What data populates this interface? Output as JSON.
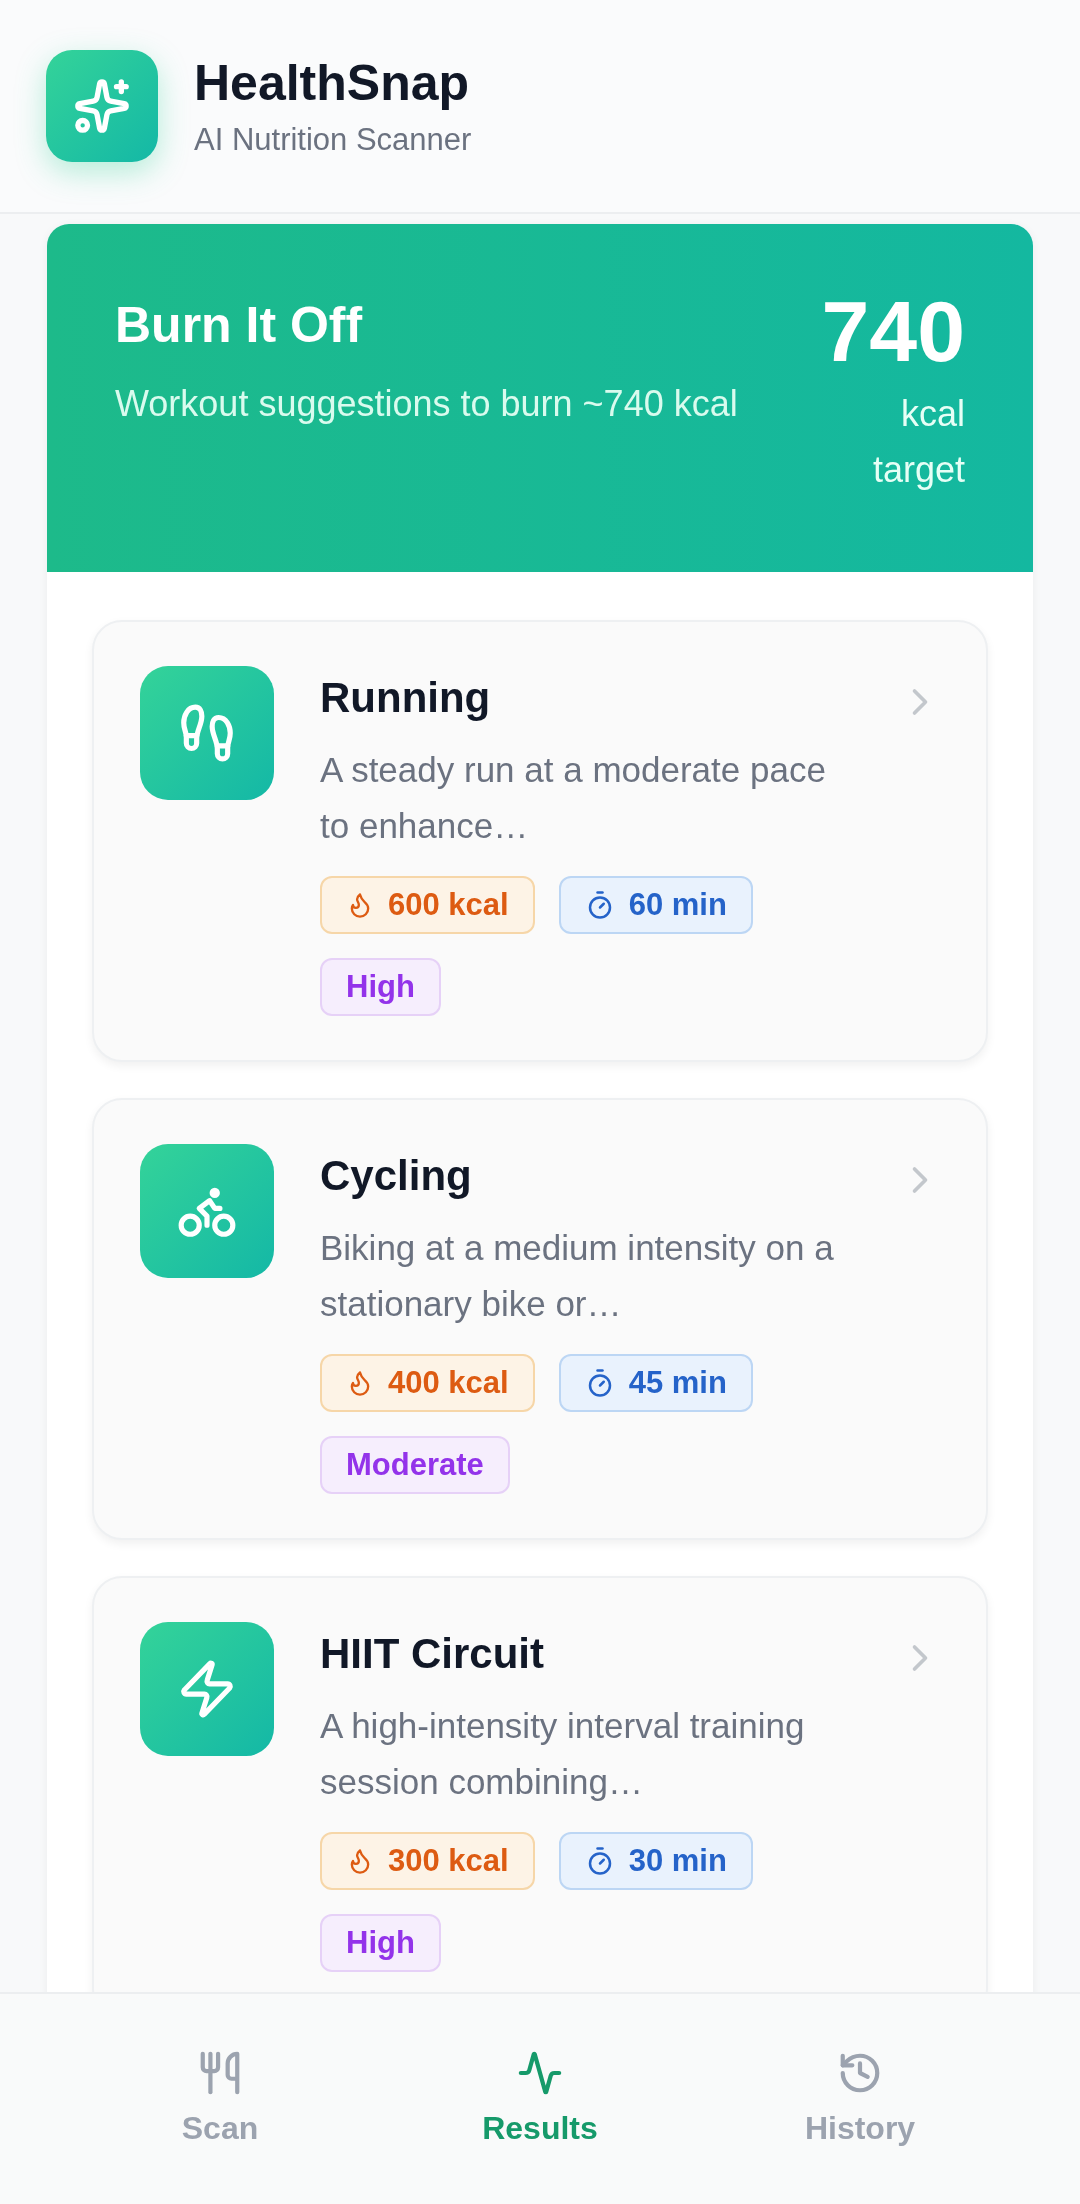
{
  "app": {
    "title": "HealthSnap",
    "subtitle": "AI Nutrition Scanner"
  },
  "hero": {
    "title": "Burn It Off",
    "subtitle": "Workout suggestions to burn ~740 kcal",
    "value": "740",
    "unit": "kcal",
    "caption": "target"
  },
  "workouts": [
    {
      "kind": "running",
      "name": "Running",
      "description": "A steady run at a moderate pace to enhance…",
      "calories": "600 kcal",
      "duration": "60 min",
      "intensity": "High"
    },
    {
      "kind": "cycling",
      "name": "Cycling",
      "description": "Biking at a medium intensity on a stationary bike or…",
      "calories": "400 kcal",
      "duration": "45 min",
      "intensity": "Moderate"
    },
    {
      "kind": "hiit",
      "name": "HIIT Circuit",
      "description": "A high-intensity interval training session combining…",
      "calories": "300 kcal",
      "duration": "30 min",
      "intensity": "High"
    }
  ],
  "nav": [
    {
      "kind": "scan",
      "label": "Scan",
      "selected": false
    },
    {
      "kind": "results",
      "label": "Results",
      "selected": true
    },
    {
      "kind": "history",
      "label": "History",
      "selected": false
    }
  ]
}
